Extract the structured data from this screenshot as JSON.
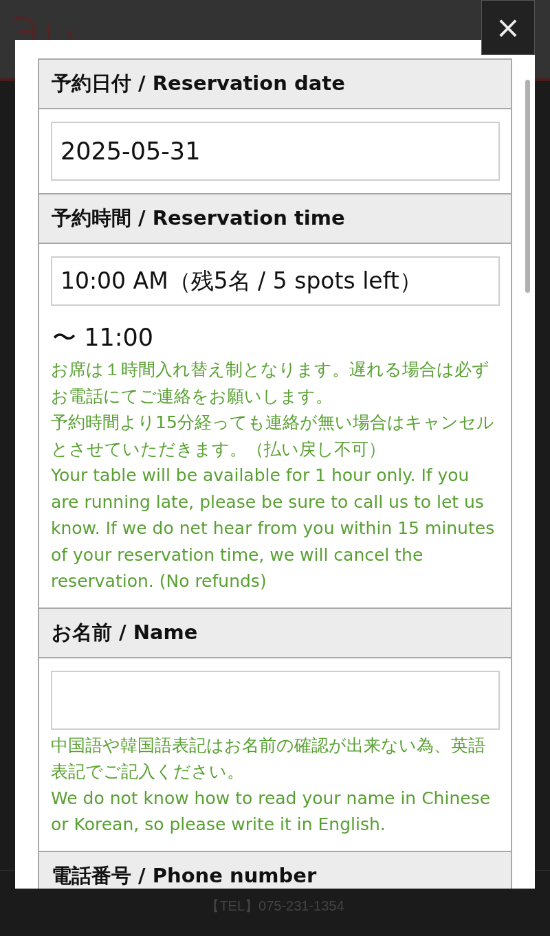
{
  "footer": {
    "tel": "【TEL】075-231-1354"
  },
  "modal": {
    "close": "×",
    "sections": [
      {
        "label": "予約日付 / Reservation date",
        "kind": "input",
        "value": "2025-05-31"
      },
      {
        "label": "予約時間 / Reservation time",
        "kind": "select",
        "value": "10:00 AM（残5名 / 5 spots left）",
        "after": "〜 11:00",
        "notes": [
          "お席は１時間入れ替え制となります。遅れる場合は必ずお電話にてご連絡をお願いします。",
          "予約時間より15分経っても連絡が無い場合はキャンセルとさせていただきます。（払い戻し不可）",
          "Your table will be available for 1 hour only. If you are running late, please be sure to call us to let us know. If we do net hear from you within 15 minutes of your reservation time, we will cancel the reservation. (No refunds)"
        ]
      },
      {
        "label": "お名前 / Name",
        "kind": "input",
        "notes": [
          "中国語や韓国語表記はお名前の確認が出来ない為、英語表記でご記入ください。",
          "We do not know how to read your name in Chinese or Korean, so please write it in English."
        ]
      },
      {
        "label": "電話番号 / Phone number"
      }
    ]
  }
}
